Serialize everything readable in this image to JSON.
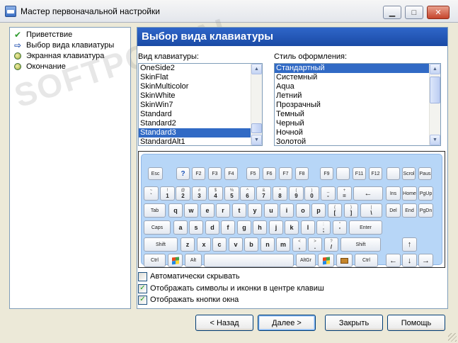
{
  "window": {
    "title": "Мастер первоначальной настройки",
    "minimize_glyph": "▁",
    "maximize_glyph": "□",
    "close_glyph": "✕"
  },
  "watermark": {
    "text": "SOFTPORTAL"
  },
  "steps": [
    {
      "label": "Приветствие",
      "icon": "check-icon",
      "state": "done"
    },
    {
      "label": "Выбор вида клавиатуры",
      "icon": "arrow-right-icon",
      "state": "current"
    },
    {
      "label": "Экранная клавиатура",
      "icon": "bullet-icon",
      "state": "pending"
    },
    {
      "label": "Окончание",
      "icon": "bullet-icon",
      "state": "pending"
    }
  ],
  "page": {
    "header": "Выбор вида клавиатуры"
  },
  "keyboard_list": {
    "label": "Вид клавиатуры:",
    "items": [
      "OneSide2",
      "SkinFlat",
      "SkinMulticolor",
      "SkinWhite",
      "SkinWin7",
      "Standard",
      "Standard2",
      "Standard3",
      "StandardAlt1"
    ],
    "selected": "Standard3"
  },
  "style_list": {
    "label": "Стиль оформления:",
    "items": [
      "Стандартный",
      "Системный",
      "Aqua",
      "Летний",
      "Прозрачный",
      "Темный",
      "Черный",
      "Ночной",
      "Золотой"
    ],
    "selected": "Стандартный"
  },
  "keyboard_preview": {
    "rows": [
      [
        [
          "Esc"
        ],
        [
          "?"
        ],
        [
          "F2"
        ],
        [
          "F3"
        ],
        [
          "F4"
        ],
        [
          "F5"
        ],
        [
          "F6"
        ],
        [
          "F7"
        ],
        [
          "F8"
        ],
        [
          "F9"
        ],
        [
          ""
        ],
        [
          "F11"
        ],
        [
          "F12"
        ],
        [
          ""
        ],
        [
          "Scrol"
        ],
        [
          "Paus"
        ]
      ],
      [
        [
          "~",
          "`"
        ],
        [
          "!",
          "1"
        ],
        [
          "@",
          "2"
        ],
        [
          "#",
          "3"
        ],
        [
          "$",
          "4"
        ],
        [
          "%",
          "5"
        ],
        [
          "^",
          "6"
        ],
        [
          "&",
          "7"
        ],
        [
          "*",
          "8"
        ],
        [
          "(",
          "9"
        ],
        [
          ")",
          "0"
        ],
        [
          "_",
          "-"
        ],
        [
          "+",
          "="
        ],
        [
          "←"
        ],
        [
          "Ins"
        ],
        [
          "Home"
        ],
        [
          "PgUp"
        ]
      ],
      [
        [
          "Tab"
        ],
        [
          "q"
        ],
        [
          "w"
        ],
        [
          "e"
        ],
        [
          "r"
        ],
        [
          "t"
        ],
        [
          "y"
        ],
        [
          "u"
        ],
        [
          "i"
        ],
        [
          "o"
        ],
        [
          "p"
        ],
        [
          "{",
          "["
        ],
        [
          "}",
          "]"
        ],
        [
          "|",
          "\\"
        ],
        [
          "Del"
        ],
        [
          "End"
        ],
        [
          "PgDn"
        ]
      ],
      [
        [
          "Caps"
        ],
        [
          "a"
        ],
        [
          "s"
        ],
        [
          "d"
        ],
        [
          "f"
        ],
        [
          "g"
        ],
        [
          "h"
        ],
        [
          "j"
        ],
        [
          "k"
        ],
        [
          "l"
        ],
        [
          ":",
          ";"
        ],
        [
          "\"",
          "'"
        ],
        [
          "Enter"
        ]
      ],
      [
        [
          "Shift"
        ],
        [
          "z"
        ],
        [
          "x"
        ],
        [
          "c"
        ],
        [
          "v"
        ],
        [
          "b"
        ],
        [
          "n"
        ],
        [
          "m"
        ],
        [
          "<",
          ","
        ],
        [
          ">",
          "."
        ],
        [
          "?",
          "/"
        ],
        [
          "Shift"
        ],
        [
          "↑"
        ]
      ],
      [
        [
          "Ctrl"
        ],
        [
          ""
        ],
        [
          "Alt"
        ],
        [
          ""
        ],
        [
          "AltGr"
        ],
        [
          ""
        ],
        [
          ""
        ],
        [
          "Ctrl"
        ],
        [
          "←"
        ],
        [
          "↓"
        ],
        [
          "→"
        ]
      ]
    ]
  },
  "options": [
    {
      "label": "Автоматически скрывать",
      "checked": false
    },
    {
      "label": "Отображать символы и иконки в центре клавиш",
      "checked": true
    },
    {
      "label": "Отображать кнопки окна",
      "checked": true
    }
  ],
  "buttons": {
    "back": "< Назад",
    "next": "Далее >",
    "close": "Закрыть",
    "help": "Помощь"
  }
}
